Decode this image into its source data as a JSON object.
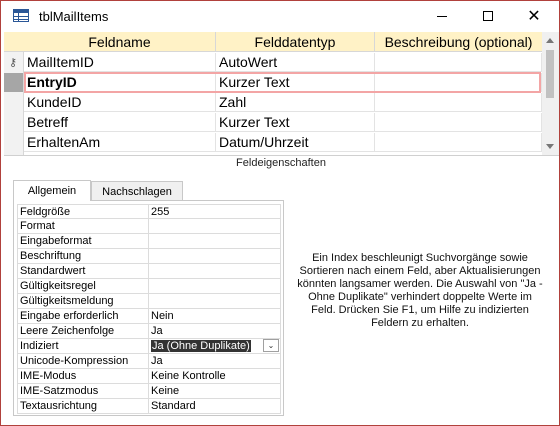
{
  "window": {
    "title": "tblMailItems",
    "icon": "table-icon",
    "close_glyph": "✕"
  },
  "grid": {
    "columns": [
      "Feldname",
      "Felddatentyp",
      "Beschreibung (optional)"
    ],
    "rows": [
      {
        "field": "MailItemID",
        "type": "AutoWert",
        "description": "",
        "primary_key": true,
        "active": false
      },
      {
        "field": "EntryID",
        "type": "Kurzer Text",
        "description": "",
        "primary_key": false,
        "active": true
      },
      {
        "field": "KundeID",
        "type": "Zahl",
        "description": "",
        "primary_key": false,
        "active": false
      },
      {
        "field": "Betreff",
        "type": "Kurzer Text",
        "description": "",
        "primary_key": false,
        "active": false
      },
      {
        "field": "ErhaltenAm",
        "type": "Datum/Uhrzeit",
        "description": "",
        "primary_key": false,
        "active": false
      }
    ]
  },
  "section_label": "Feldeigenschaften",
  "tabs": [
    {
      "label": "Allgemein",
      "active": true
    },
    {
      "label": "Nachschlagen",
      "active": false
    }
  ],
  "properties": [
    {
      "name": "Feldgröße",
      "value": "255"
    },
    {
      "name": "Format",
      "value": ""
    },
    {
      "name": "Eingabeformat",
      "value": ""
    },
    {
      "name": "Beschriftung",
      "value": ""
    },
    {
      "name": "Standardwert",
      "value": ""
    },
    {
      "name": "Gültigkeitsregel",
      "value": ""
    },
    {
      "name": "Gültigkeitsmeldung",
      "value": ""
    },
    {
      "name": "Eingabe erforderlich",
      "value": "Nein"
    },
    {
      "name": "Leere Zeichenfolge",
      "value": "Ja"
    },
    {
      "name": "Indiziert",
      "value": "Ja (Ohne Duplikate)",
      "selected": true,
      "dropdown": true
    },
    {
      "name": "Unicode-Kompression",
      "value": "Ja"
    },
    {
      "name": "IME-Modus",
      "value": "Keine Kontrolle"
    },
    {
      "name": "IME-Satzmodus",
      "value": "Keine"
    },
    {
      "name": "Textausrichtung",
      "value": "Standard"
    }
  ],
  "help_text": "Ein Index beschleunigt Suchvorgänge sowie Sortieren nach einem Feld, aber Aktualisierungen könnten langsamer werden. Die Auswahl von \"Ja - Ohne Duplikate\" verhindert doppelte Werte im Feld. Drücken Sie F1, um Hilfe zu indizierten Feldern zu erhalten.",
  "colors": {
    "header_bg": "#fff2c6",
    "active_row_border": "#f3a5a5",
    "window_border": "#b1413c",
    "selector_active": "#a6a6a6"
  }
}
